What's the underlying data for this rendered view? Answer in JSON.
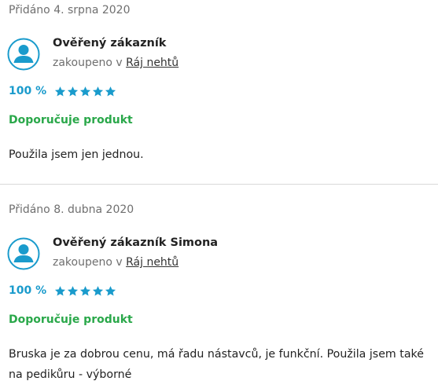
{
  "colors": {
    "accent": "#1a9bcc",
    "recommend": "#2aa84a",
    "muted_text": "#6f6f6f",
    "divider": "#d9d9d9"
  },
  "reviews": [
    {
      "added": "Přidáno 4. srpna 2020",
      "avatar_icon": "user-icon",
      "author": "Ověřený zákazník",
      "bought_prefix": "zakoupeno v",
      "shop": "Ráj nehtů",
      "rating_percent": "100 %",
      "stars": 5,
      "max_stars": 5,
      "recommend": "Doporučuje produkt",
      "text": "Použila jsem jen jednou."
    },
    {
      "added": "Přidáno 8. dubna 2020",
      "avatar_icon": "user-icon",
      "author": "Ověřený zákazník Simona",
      "bought_prefix": "zakoupeno v",
      "shop": "Ráj nehtů",
      "rating_percent": "100 %",
      "stars": 5,
      "max_stars": 5,
      "recommend": "Doporučuje produkt",
      "text": "Bruska je za dobrou cenu, má řadu nástavců, je funkční. Použila jsem také na pedikůru - výborné"
    }
  ]
}
